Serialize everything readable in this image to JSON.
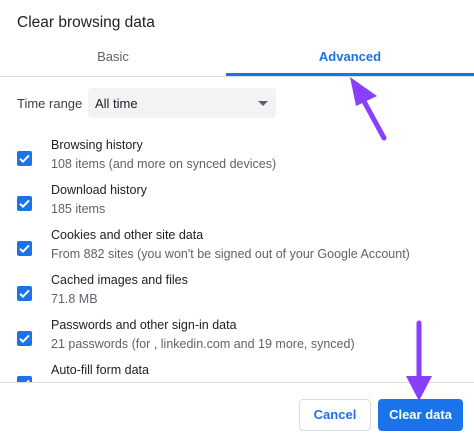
{
  "dialog": {
    "title": "Clear browsing data",
    "tabs": [
      {
        "label": "Basic",
        "selected": false
      },
      {
        "label": "Advanced",
        "selected": true
      }
    ],
    "time_range": {
      "label": "Time range",
      "value": "All time"
    },
    "items": [
      {
        "title": "Browsing history",
        "desc": "108 items (and more on synced devices)",
        "checked": true
      },
      {
        "title": "Download history",
        "desc": "185 items",
        "checked": true
      },
      {
        "title": "Cookies and other site data",
        "desc": "From 882 sites (you won't be signed out of your Google Account)",
        "checked": true
      },
      {
        "title": "Cached images and files",
        "desc": "71.8 MB",
        "checked": true
      },
      {
        "title": "Passwords and other sign-in data",
        "desc": "21 passwords (for , linkedin.com and 19 more, synced)",
        "checked": true
      },
      {
        "title": "Auto-fill form data",
        "desc": "",
        "checked": true
      }
    ],
    "buttons": {
      "cancel": "Cancel",
      "clear": "Clear data"
    }
  },
  "annotation_color": "#8a3ffc",
  "colors": {
    "accent": "#1a73e8"
  }
}
